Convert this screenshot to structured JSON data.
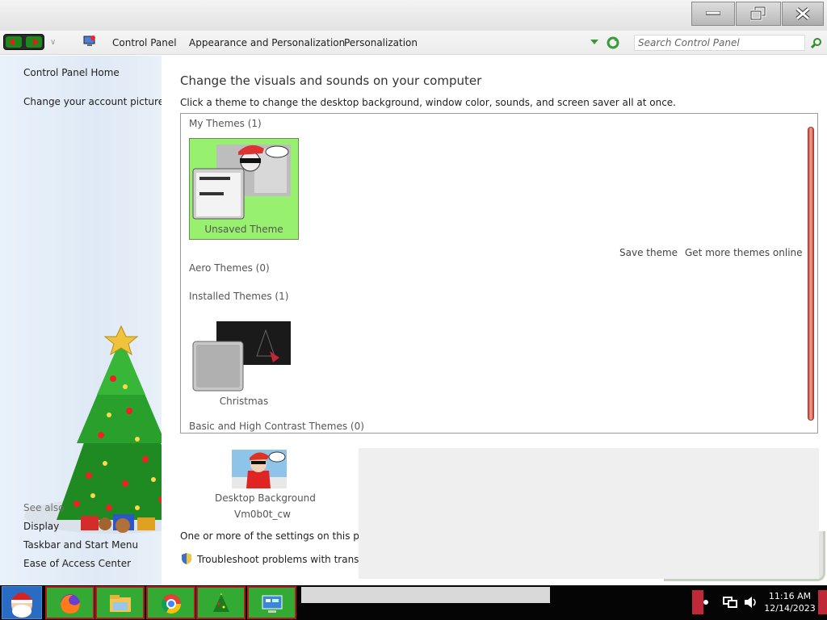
{
  "window": {
    "buttons": {
      "minimize": "minimize",
      "restore": "restore",
      "close": "close"
    }
  },
  "address_bar": {
    "breadcrumbs": [
      "Control Panel",
      "Appearance and Personalization",
      "Personalization"
    ],
    "search_placeholder": "Search Control Panel"
  },
  "left_pane": {
    "links": [
      "Control Panel Home",
      "Change your account picture"
    ],
    "see_also_label": "See also",
    "see_also_links": [
      "Display",
      "Taskbar and Start Menu",
      "Ease of Access Center"
    ]
  },
  "main": {
    "heading": "Change the visuals and sounds on your computer",
    "subheading": "Click a theme to change the desktop background, window color, sounds, and screen saver all at once.",
    "groups": {
      "my_themes": "My Themes (1)",
      "aero_themes": "Aero Themes (0)",
      "installed_themes": "Installed Themes (1)",
      "basic_themes": "Basic and High Contrast Themes (0)"
    },
    "themes": {
      "unsaved": "Unsaved Theme",
      "christmas": "Christmas"
    },
    "actions": {
      "save_theme": "Save theme",
      "get_more": "Get more themes online"
    },
    "desktop_background": {
      "label": "Desktop Background",
      "value": "Vm0b0t_cw"
    },
    "notice": "One or more of the settings on this page h",
    "troubleshoot": "Troubleshoot problems with transpare"
  },
  "taskbar": {
    "time": "11:16 AM",
    "date": "12/14/2023"
  },
  "colors": {
    "selected_theme_bg": "#98f06f",
    "taskbar_item_bg": "#33aa33",
    "taskbar_item_border": "#b21b1b",
    "scrollbar": "#e58b7b"
  }
}
